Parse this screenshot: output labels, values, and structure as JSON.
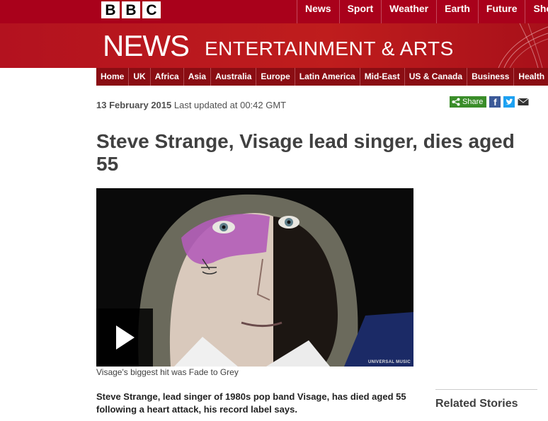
{
  "bbc_logo": [
    "B",
    "B",
    "C"
  ],
  "top_nav": [
    "News",
    "Sport",
    "Weather",
    "Earth",
    "Future",
    "Shop"
  ],
  "banner": {
    "news": "NEWS",
    "section": "ENTERTAINMENT & ARTS"
  },
  "sub_nav": [
    "Home",
    "UK",
    "Africa",
    "Asia",
    "Australia",
    "Europe",
    "Latin America",
    "Mid-East",
    "US & Canada",
    "Business",
    "Health"
  ],
  "article": {
    "date": "13 February 2015",
    "updated": "Last updated at 00:42 GMT",
    "share_label": "Share",
    "headline": "Steve Strange, Visage lead singer, dies aged 55",
    "video_credit": "UNIVERSAL MUSIC",
    "caption": "Visage's biggest hit was Fade to Grey",
    "intro": "Steve Strange, lead singer of 1980s pop band Visage, has died aged 55 following a heart attack, his record label says."
  },
  "sidebar": {
    "related_title": "Related Stories"
  },
  "colors": {
    "bbc_red": "#a9011b",
    "banner_red": "#bb1919",
    "subnav_red": "#8a0d13",
    "share_green": "#3a8d29"
  }
}
